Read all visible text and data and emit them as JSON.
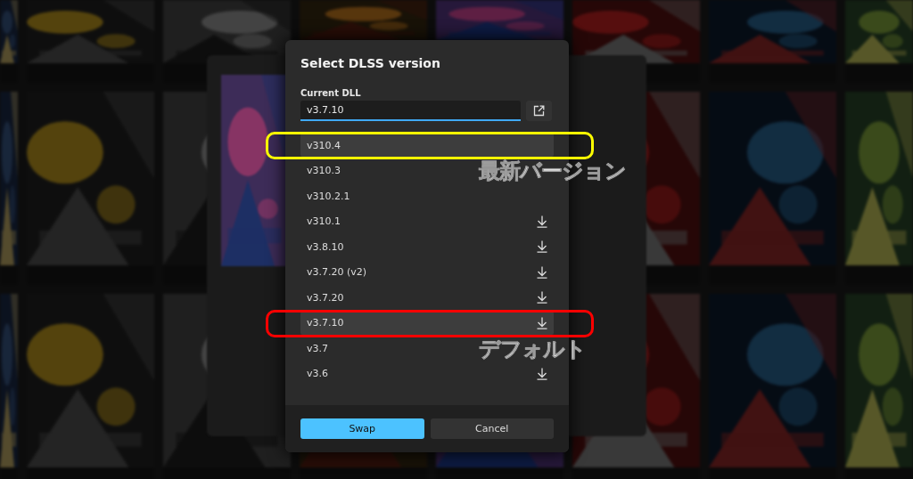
{
  "dialog": {
    "title": "Select DLSS version",
    "current_dll_label": "Current DLL",
    "current_dll": "v3.7.10",
    "versions": [
      {
        "label": "v310.4",
        "highlighted": true,
        "downloaded": true,
        "callout": {
          "text": "最新バージョン",
          "color": "#ffff00"
        }
      },
      {
        "label": "v310.3",
        "highlighted": false,
        "downloaded": true
      },
      {
        "label": "v310.2.1",
        "highlighted": false,
        "downloaded": true
      },
      {
        "label": "v310.1",
        "highlighted": false,
        "downloaded": false
      },
      {
        "label": "v3.8.10",
        "highlighted": false,
        "downloaded": false
      },
      {
        "label": "v3.7.20 (v2)",
        "highlighted": false,
        "downloaded": false
      },
      {
        "label": "v3.7.20",
        "highlighted": false,
        "downloaded": false
      },
      {
        "label": "v3.7.10",
        "highlighted": true,
        "downloaded": false,
        "callout": {
          "text": "デフォルト",
          "color": "#ff0000"
        }
      },
      {
        "label": "v3.7",
        "highlighted": false,
        "downloaded": true
      },
      {
        "label": "v3.6",
        "highlighted": false,
        "downloaded": false
      }
    ],
    "buttons": [
      {
        "label": "Swap",
        "primary": true
      },
      {
        "label": "Cancel",
        "primary": false
      }
    ]
  }
}
